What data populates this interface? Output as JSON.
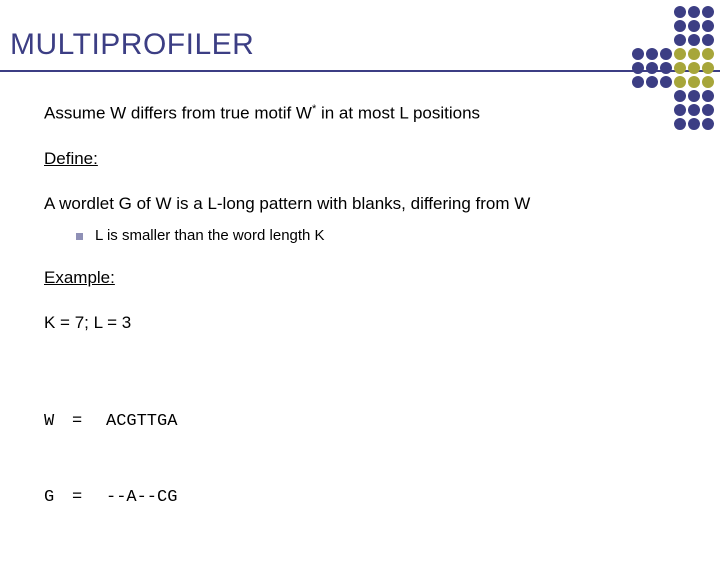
{
  "title": "MULTIPROFILER",
  "body": {
    "assume_pre": "Assume W differs from true motif W",
    "assume_sup": "*",
    "assume_post": " in at most L positions",
    "define_heading": "Define:",
    "wordlet_def": "A wordlet G of W is a L-long pattern with blanks, differing from W",
    "bullet": "L is smaller than the word length K",
    "example_heading": "Example:",
    "params": "K = 7; L = 3",
    "mono": {
      "w_label": "W",
      "eq": "=",
      "w_value": "ACGTTGA",
      "g_label": "G",
      "g_value": "--A--CG"
    }
  },
  "dots": {
    "dark": "#3c3e84",
    "olive": "#a7a63a",
    "grid": [
      [
        0,
        0,
        0,
        1,
        1,
        1
      ],
      [
        0,
        0,
        0,
        1,
        1,
        1
      ],
      [
        0,
        0,
        0,
        1,
        1,
        1
      ],
      [
        1,
        1,
        1,
        2,
        2,
        2
      ],
      [
        1,
        1,
        1,
        2,
        2,
        2
      ],
      [
        1,
        1,
        1,
        2,
        2,
        2
      ],
      [
        0,
        0,
        0,
        1,
        1,
        1
      ],
      [
        0,
        0,
        0,
        1,
        1,
        1
      ],
      [
        0,
        0,
        0,
        1,
        1,
        1
      ]
    ]
  }
}
